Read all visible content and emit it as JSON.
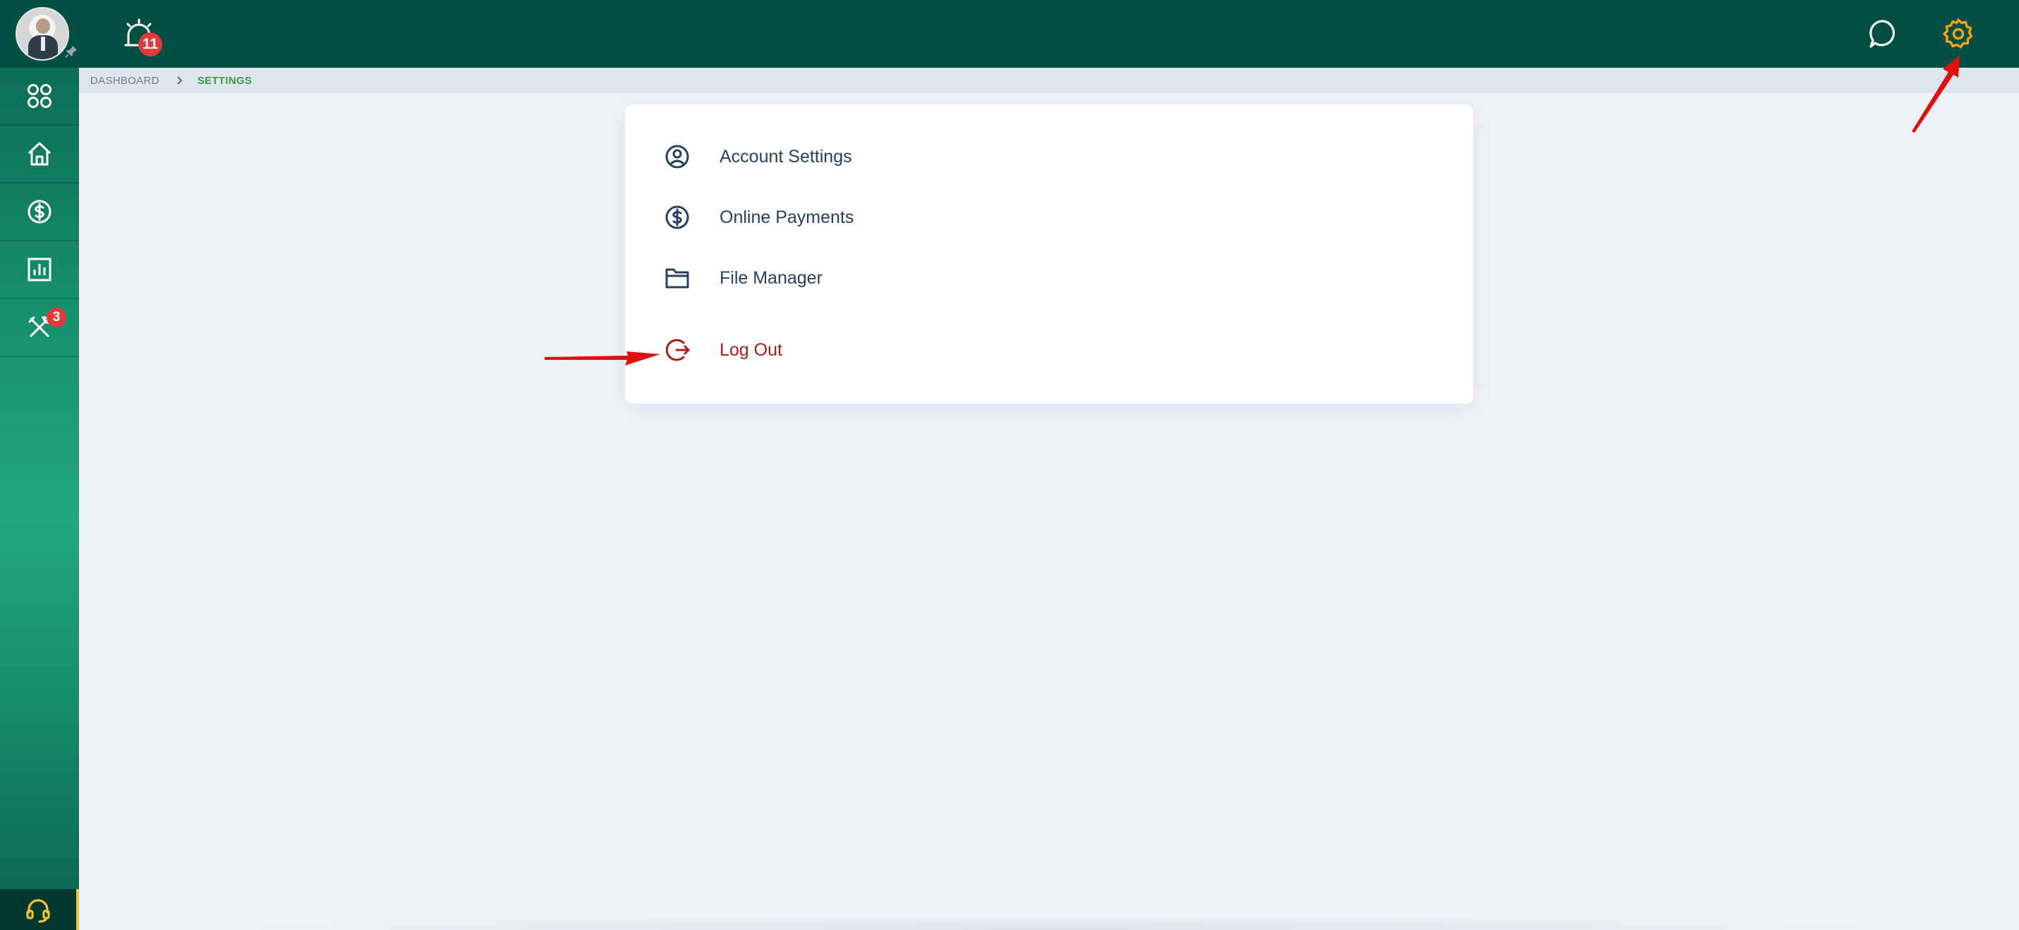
{
  "header": {
    "notification_count": "11",
    "icons": {
      "alarm": "alarm-clock-icon",
      "chat": "chat-bubble-icon",
      "settings": "gear-icon"
    }
  },
  "sidebar": {
    "items": [
      {
        "icon": "apps-grid-icon"
      },
      {
        "icon": "home-icon"
      },
      {
        "icon": "dollar-circle-icon"
      },
      {
        "icon": "bar-chart-icon"
      },
      {
        "icon": "tools-icon",
        "badge": "3"
      }
    ],
    "support_icon": "headset-icon"
  },
  "breadcrumb": {
    "items": [
      "DASHBOARD",
      "SETTINGS"
    ]
  },
  "settings_menu": {
    "items": [
      {
        "label": "Account Settings",
        "icon": "user-circle-icon"
      },
      {
        "label": "Online Payments",
        "icon": "dollar-circle-icon"
      },
      {
        "label": "File Manager",
        "icon": "folder-icon"
      },
      {
        "label": "Log Out",
        "icon": "logout-icon"
      }
    ]
  },
  "colors": {
    "topbar": "#034f43",
    "sidebar_mid": "#23a77f",
    "accent_gear": "#f0a419",
    "breadcrumb_current": "#3f9a3c",
    "logout_text": "#a61b1b",
    "badge": "#e03b3b",
    "annotation_arrow": "#e01010"
  }
}
